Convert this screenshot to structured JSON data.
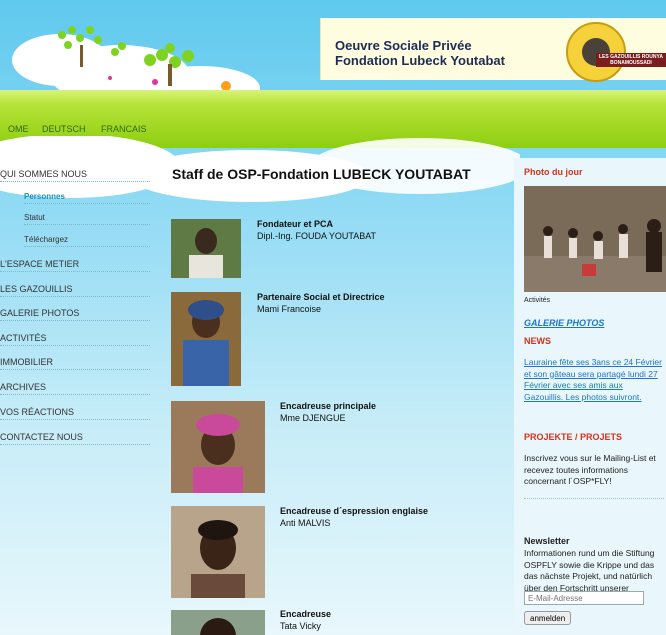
{
  "banner": {
    "line1": "Oeuvre Sociale Privée",
    "line2": "Fondation Lubeck Youtabat",
    "seal_text": "LES GAZOUILLIS ROUNYA BONAMOUSSADI"
  },
  "nav": {
    "items": [
      "OME",
      "DEUTSCH",
      "FRANCAIS"
    ]
  },
  "sidebar": {
    "items": [
      {
        "label": "QUI SOMMES NOUS"
      },
      {
        "label": "Personnes"
      },
      {
        "label": "Statut"
      },
      {
        "label": "Téléchargez"
      },
      {
        "label": "L'ESPACE METIER"
      },
      {
        "label": "LES GAZOUILLIS"
      },
      {
        "label": "GALERIE PHOTOS"
      },
      {
        "label": "ACTIVITÉS"
      },
      {
        "label": "IMMOBILIER"
      },
      {
        "label": "ARCHIVES"
      },
      {
        "label": "VOS RÉACTIONS"
      },
      {
        "label": "CONTACTEZ NOUS"
      }
    ]
  },
  "main": {
    "title": "Staff de OSP-Fondation LUBECK YOUTABAT",
    "staff": [
      {
        "role": "Fondateur et PCA",
        "name": "Dipl.-Ing. FOUDA YOUTABAT"
      },
      {
        "role": "Partenaire Social et Directrice",
        "name": "Mami Francoise"
      },
      {
        "role": "Encadreuse principale",
        "name": "Mme DJENGUE"
      },
      {
        "role": "Encadreuse d´espression englaise",
        "name": "Anti MALVIS"
      },
      {
        "role": "Encadreuse",
        "name": "Tata Vicky"
      }
    ]
  },
  "right": {
    "photo_head": "Photo du jour",
    "photo_caption": "Activités",
    "gallery_link": "GALERIE PHOTOS",
    "news_head": "NEWS",
    "news_link": "Lauraine fête ses 3ans ce 24 Février et son gâteau sera partagé lundi 27 Février avec ses amis aux Gazouillis. Les photos suivront.",
    "projekte_head": "PROJEKTE / PROJETS",
    "projekte_text": "Inscrivez vous sur le Mailing-List et recevez toutes informations concernant l´OSP*FLY!",
    "newsletter_head": "Newsletter",
    "newsletter_text": "Informationen rund um die Stiftung OSPFLY sowie die Krippe und das das nächste Projekt, und natürlich über den Fortschritt unserer Webseite!",
    "email_placeholder": "E-Mail-Adresse",
    "submit_label": "anmelden"
  }
}
